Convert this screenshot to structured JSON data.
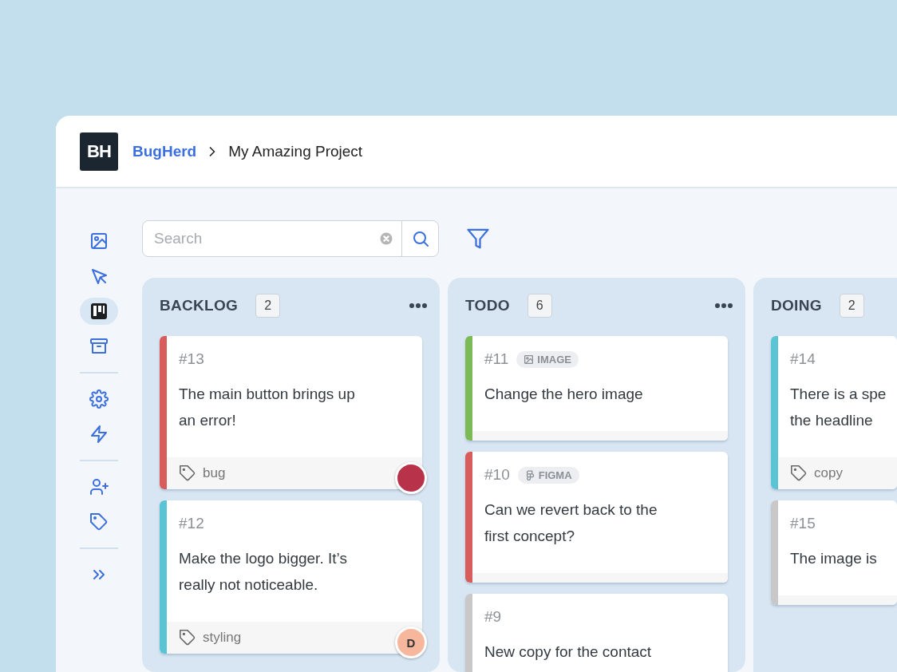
{
  "header": {
    "logo": "BH",
    "breadcrumb": [
      {
        "label": "BugHerd",
        "kind": "link"
      },
      {
        "label": "My Amazing Project",
        "kind": "current"
      }
    ]
  },
  "sidebar": {
    "groups": [
      [
        {
          "kind": "image",
          "selected": false
        },
        {
          "kind": "pointer",
          "selected": false
        },
        {
          "kind": "board",
          "selected": true
        },
        {
          "kind": "archive",
          "selected": false
        }
      ],
      [
        {
          "kind": "settings",
          "selected": false
        },
        {
          "kind": "bolt",
          "selected": false
        }
      ],
      [
        {
          "kind": "add-user",
          "selected": false
        },
        {
          "kind": "tag",
          "selected": false
        }
      ],
      [
        {
          "kind": "expand",
          "selected": false
        }
      ]
    ]
  },
  "search": {
    "placeholder": "Search"
  },
  "columns": [
    {
      "title": "BACKLOG",
      "count": "2",
      "cards": [
        {
          "id": "#13",
          "title": "The main button brings up an error!",
          "color": "#d95c5c",
          "tag": "bug",
          "avatar": {
            "kind": "photo"
          }
        },
        {
          "id": "#12",
          "title": "Make the logo bigger. It’s really not noticeable.",
          "color": "#5bc4d4",
          "tag": "styling",
          "avatar": {
            "kind": "initial",
            "text": "D"
          }
        }
      ]
    },
    {
      "title": "TODO",
      "count": "6",
      "cards": [
        {
          "id": "#11",
          "badge": {
            "kind": "image",
            "label": "IMAGE"
          },
          "title": "Change the hero image",
          "color": "#7cb957"
        },
        {
          "id": "#10",
          "badge": {
            "kind": "figma",
            "label": "FIGMA"
          },
          "title": "Can we revert back to the first concept?",
          "color": "#d95c5c"
        },
        {
          "id": "#9",
          "title": "New copy for the contact",
          "color": "#c8c8c8"
        }
      ]
    },
    {
      "title": "DOING",
      "count": "2",
      "cards": [
        {
          "id": "#14",
          "lines": [
            "There is a spe",
            "the headline"
          ],
          "color": "#5bc4d4",
          "tag": "copy"
        },
        {
          "id": "#15",
          "title": "The image is",
          "color": "#c8c8c8"
        }
      ]
    }
  ]
}
